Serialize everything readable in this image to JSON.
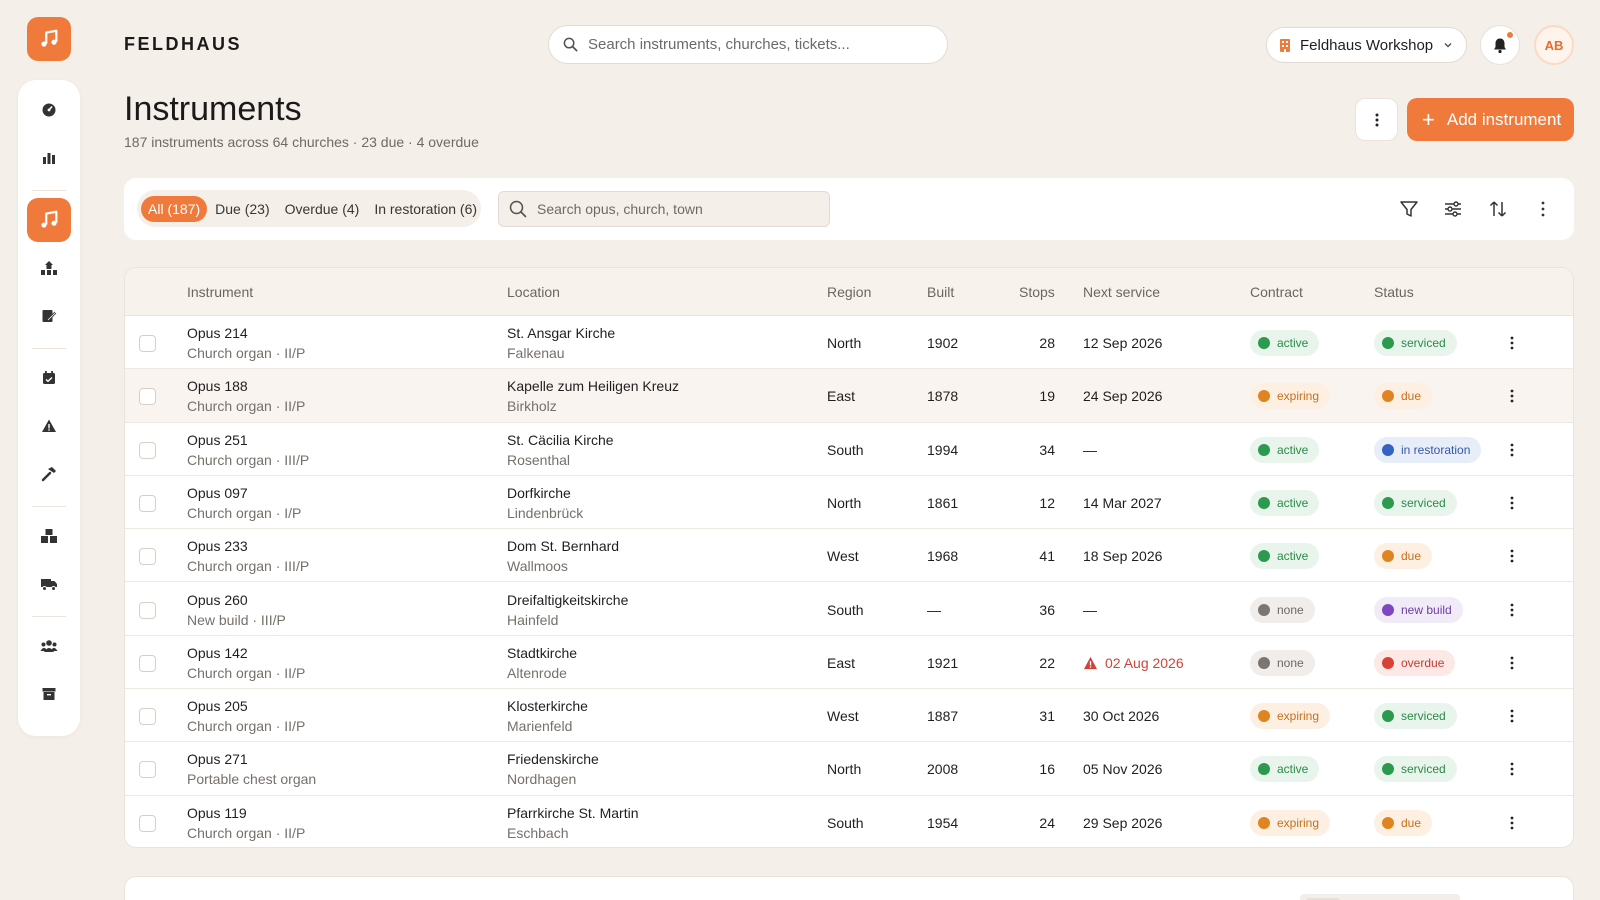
{
  "app": {
    "brand": "FELDHAUS"
  },
  "search": {
    "placeholder": "Search instruments, churches, tickets..."
  },
  "workspace": {
    "label": "Feldhaus Workshop"
  },
  "user": {
    "initials": "AB"
  },
  "page": {
    "title": "Instruments",
    "subtitle": "187 instruments across 64 churches · 23 due · 4 overdue",
    "add_label": "Add instrument"
  },
  "filters": {
    "tabs": [
      "All (187)",
      "Due (23)",
      "Overdue (4)",
      "In restoration (6)"
    ],
    "active_tab": 0,
    "search_placeholder": "Search opus, church, town"
  },
  "table": {
    "columns": [
      "Instrument",
      "Location",
      "Region",
      "Built",
      "Stops",
      "Next service",
      "Contract",
      "Status"
    ],
    "rows": [
      {
        "opus": "Opus 214",
        "type": "Church organ · II/P",
        "church": "St. Ansgar Kirche",
        "town": "Falkenau",
        "region": "North",
        "built": "1902",
        "stops": "28",
        "next_service": "12 Sep 2026",
        "overdue": false,
        "contract": "active",
        "status": "serviced"
      },
      {
        "opus": "Opus 188",
        "type": "Church organ · II/P",
        "church": "Kapelle zum Heiligen Kreuz",
        "town": "Birkholz",
        "region": "East",
        "built": "1878",
        "stops": "19",
        "next_service": "24 Sep 2026",
        "overdue": false,
        "contract": "expiring",
        "status": "due",
        "highlighted": true
      },
      {
        "opus": "Opus 251",
        "type": "Church organ · III/P",
        "church": "St. Cäcilia Kirche",
        "town": "Rosenthal",
        "region": "South",
        "built": "1994",
        "stops": "34",
        "next_service": "—",
        "overdue": false,
        "contract": "active",
        "status": "in restoration"
      },
      {
        "opus": "Opus 097",
        "type": "Church organ · I/P",
        "church": "Dorfkirche",
        "town": "Lindenbrück",
        "region": "North",
        "built": "1861",
        "stops": "12",
        "next_service": "14 Mar 2027",
        "overdue": false,
        "contract": "active",
        "status": "serviced"
      },
      {
        "opus": "Opus 233",
        "type": "Church organ · III/P",
        "church": "Dom St. Bernhard",
        "town": "Wallmoos",
        "region": "West",
        "built": "1968",
        "stops": "41",
        "next_service": "18 Sep 2026",
        "overdue": false,
        "contract": "active",
        "status": "due"
      },
      {
        "opus": "Opus 260",
        "type": "New build · III/P",
        "church": "Dreifaltigkeitskirche",
        "town": "Hainfeld",
        "region": "South",
        "built": "—",
        "stops": "36",
        "next_service": "—",
        "overdue": false,
        "contract": "none",
        "status": "new build"
      },
      {
        "opus": "Opus 142",
        "type": "Church organ · II/P",
        "church": "Stadtkirche",
        "town": "Altenrode",
        "region": "East",
        "built": "1921",
        "stops": "22",
        "next_service": "02 Aug 2026",
        "overdue": true,
        "contract": "none",
        "status": "overdue"
      },
      {
        "opus": "Opus 205",
        "type": "Church organ · II/P",
        "church": "Klosterkirche",
        "town": "Marienfeld",
        "region": "West",
        "built": "1887",
        "stops": "31",
        "next_service": "30 Oct 2026",
        "overdue": false,
        "contract": "expiring",
        "status": "serviced"
      },
      {
        "opus": "Opus 271",
        "type": "Portable chest organ",
        "church": "Friedenskirche",
        "town": "Nordhagen",
        "region": "North",
        "built": "2008",
        "stops": "16",
        "next_service": "05 Nov 2026",
        "overdue": false,
        "contract": "active",
        "status": "serviced"
      },
      {
        "opus": "Opus 119",
        "type": "Church organ · II/P",
        "church": "Pfarrkirche St. Martin",
        "town": "Eschbach",
        "region": "South",
        "built": "1954",
        "stops": "24",
        "next_service": "29 Sep 2026",
        "overdue": false,
        "contract": "expiring",
        "status": "due"
      }
    ]
  },
  "pill_colors": {
    "active": "green",
    "expiring": "orange",
    "none": "grey",
    "serviced": "green",
    "due": "orange",
    "in restoration": "blue",
    "new build": "purple",
    "overdue": "red"
  },
  "colors": {
    "accent": "#f07a3c",
    "background": "#f5efe9",
    "overdue": "#d0433a"
  },
  "icons": {
    "rail": [
      "dashboard-icon",
      "chart-icon",
      "music-note-icon",
      "hierarchy-icon",
      "edit-icon",
      "calendar-icon",
      "warning-icon",
      "hammer-icon",
      "boxes-icon",
      "truck-icon",
      "users-icon",
      "archive-icon"
    ],
    "toolbar": [
      "filter-icon",
      "sliders-icon",
      "sort-icon",
      "more-vertical-icon"
    ]
  }
}
